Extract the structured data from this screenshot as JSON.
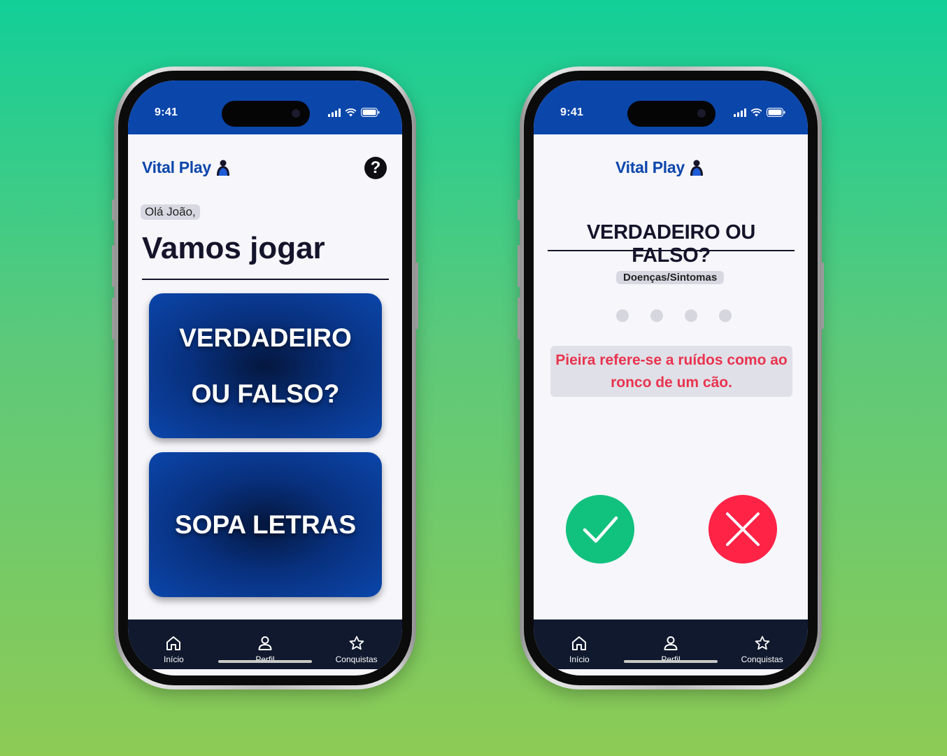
{
  "colors": {
    "brand": "#0b46ab",
    "true_button": "#11c17e",
    "false_button": "#ff2346",
    "statement_text": "#e8344f"
  },
  "status_bar": {
    "time": "9:41"
  },
  "brand": {
    "name": "Vital Play",
    "icon": "person-hoodie-icon"
  },
  "home": {
    "greeting": "Olá João,",
    "title": "Vamos jogar",
    "help_label": "?",
    "games": [
      {
        "line1": "VERDADEIRO",
        "line2": "OU FALSO?"
      },
      {
        "label": "SOPA LETRAS"
      }
    ]
  },
  "quiz": {
    "title": "VERDADEIRO OU FALSO?",
    "category": "Doenças/Sintomas",
    "progress_total": 4,
    "progress_done": 0,
    "statement": "Pieira refere-se a ruídos como ao ronco de um cão.",
    "true_icon": "check-icon",
    "false_icon": "x-icon"
  },
  "nav": {
    "items": [
      {
        "label": "Início",
        "icon": "home-icon"
      },
      {
        "label": "Perfil",
        "icon": "user-icon"
      },
      {
        "label": "Conquistas",
        "icon": "star-icon"
      }
    ]
  }
}
